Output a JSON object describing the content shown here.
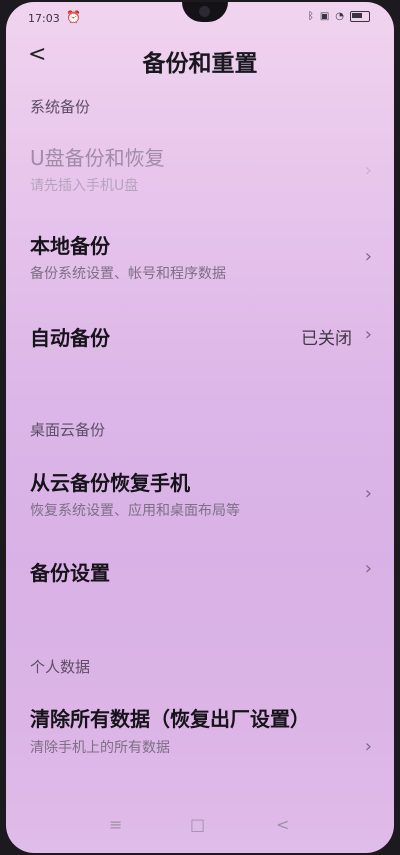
{
  "status": {
    "time": "17:03",
    "alarm_icon": "alarm-icon",
    "icons": [
      "bluetooth-icon",
      "vibrate-icon",
      "wifi-icon",
      "battery-icon"
    ]
  },
  "header": {
    "back_symbol": "<",
    "title": "备份和重置"
  },
  "sections": {
    "system_backup": {
      "title": "系统备份",
      "usb": {
        "title": "U盘备份和恢复",
        "subtitle": "请先插入手机U盘"
      },
      "local": {
        "title": "本地备份",
        "subtitle": "备份系统设置、帐号和程序数据"
      },
      "auto": {
        "title": "自动备份",
        "value": "已关闭"
      }
    },
    "desktop_cloud": {
      "title": "桌面云备份",
      "restore": {
        "title": "从云备份恢复手机",
        "subtitle": "恢复系统设置、应用和桌面布局等"
      },
      "settings": {
        "title": "备份设置"
      }
    },
    "personal_data": {
      "title": "个人数据",
      "clear": {
        "title": "清除所有数据（恢复出厂设置）",
        "subtitle": "清除手机上的所有数据"
      }
    }
  },
  "navbar": {
    "menu": "≡",
    "home": "□",
    "back": "<"
  },
  "colors": {
    "background_top": "#f0d4ef",
    "background_bottom": "#dcb5e6",
    "title_text": "#17131a",
    "subtitle_text": "#7d6f85"
  }
}
